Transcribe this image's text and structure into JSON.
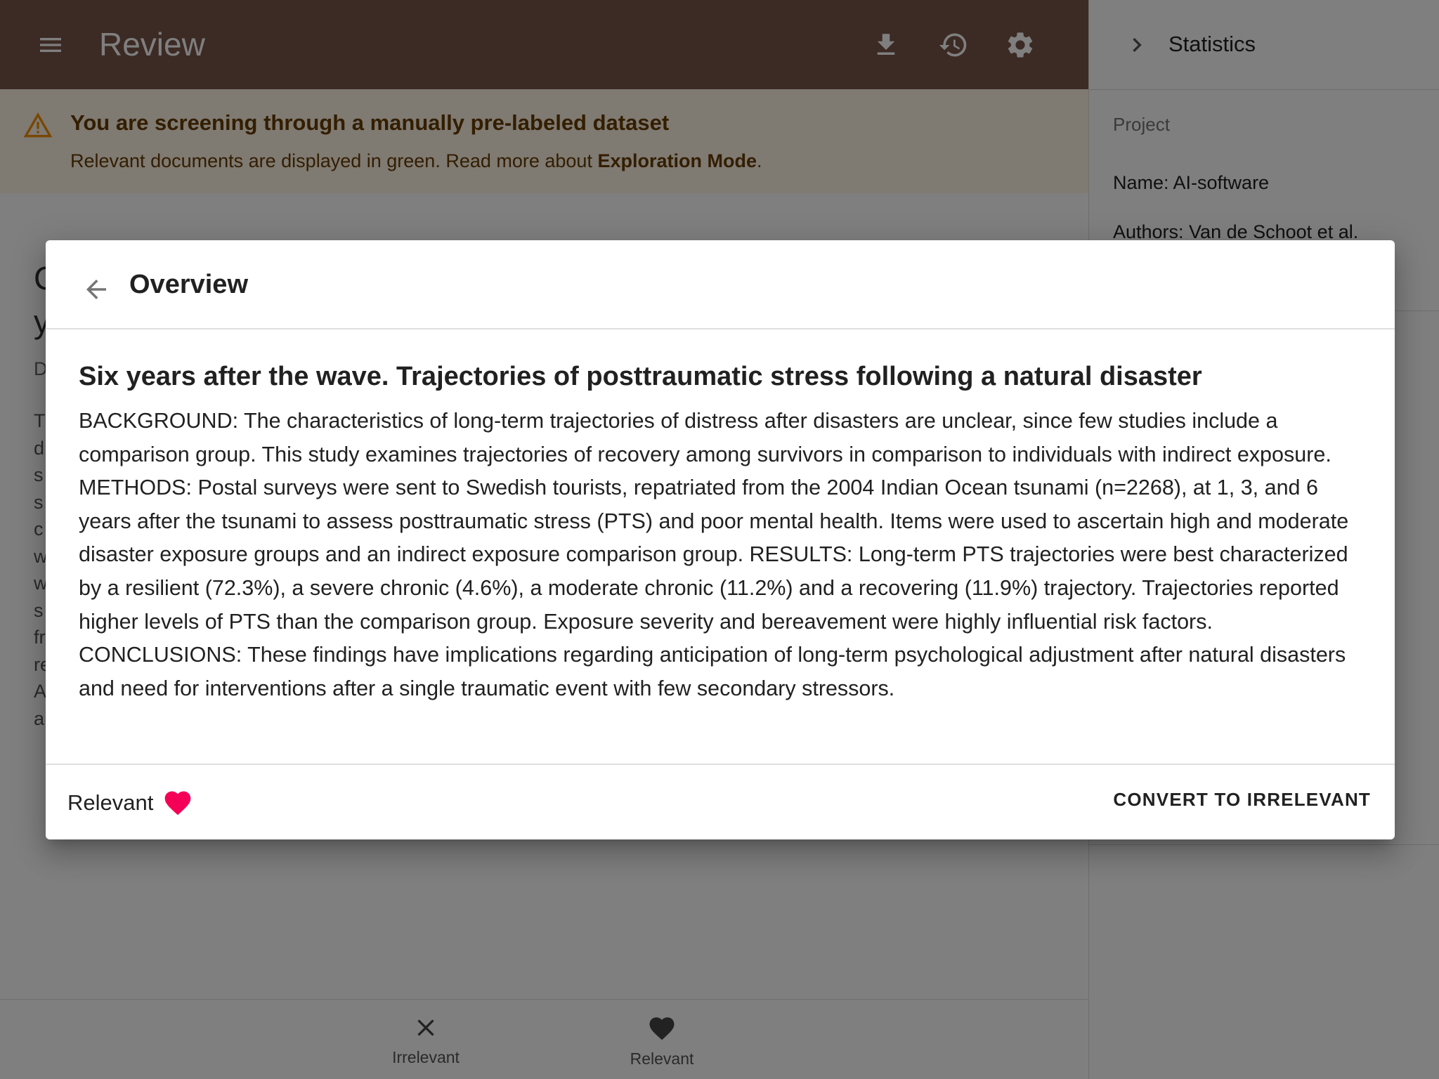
{
  "app": {
    "title": "Review"
  },
  "alert": {
    "title": "You are screening through a manually pre-labeled dataset",
    "text_before": "Relevant documents are displayed in green. Read more about ",
    "link": "Exploration Mode",
    "text_after": "."
  },
  "side": {
    "title": "Statistics",
    "section": "Project",
    "name": "Name: AI-software",
    "authors": "Authors: Van de Schoot et al."
  },
  "actions": {
    "irrelevant": "Irrelevant",
    "relevant": "Relevant"
  },
  "dialog": {
    "title": "Overview",
    "doc_title": "Six years after the wave. Trajectories of posttraumatic stress following a natural disaster",
    "abstract": "BACKGROUND: The characteristics of long-term trajectories of distress after disasters are unclear, since few studies include a comparison group. This study examines trajectories of recovery among survivors in comparison to individuals with indirect exposure. METHODS: Postal surveys were sent to Swedish tourists, repatriated from the 2004 Indian Ocean tsunami (n=2268), at 1, 3, and 6 years after the tsunami to assess posttraumatic stress (PTS) and poor mental health. Items were used to ascertain high and moderate disaster exposure groups and an indirect exposure comparison group. RESULTS: Long-term PTS trajectories were best characterized by a resilient (72.3%), a severe chronic (4.6%), a moderate chronic (11.2%) and a recovering (11.9%) trajectory. Trajectories reported higher levels of PTS than the comparison group. Exposure severity and bereavement were highly influential risk factors. CONCLUSIONS: These findings have implications regarding anticipation of long-term psychological adjustment after natural disasters and need for interventions after a single traumatic event with few secondary stressors.",
    "label_status": "Relevant",
    "convert_button": "CONVERT TO IRRELEVANT"
  },
  "colors": {
    "appbar": "#795548",
    "alert_bg": "#fff4e5",
    "alert_text": "#663c00",
    "heart": "#f50057"
  },
  "icons": [
    "menu-icon",
    "download-icon",
    "history-icon",
    "settings-icon",
    "chevron-right-icon",
    "warning-icon",
    "arrow-back-icon",
    "heart-icon",
    "close-icon"
  ]
}
